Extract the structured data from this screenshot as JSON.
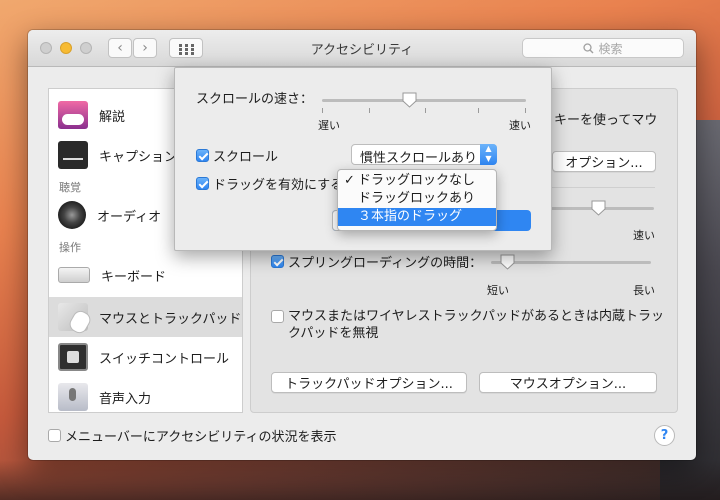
{
  "window": {
    "title": "アクセシビリティ",
    "search_placeholder": "検索"
  },
  "sidebar": {
    "items": [
      {
        "label": "解説",
        "icon": "speech-bubble-icon"
      },
      {
        "label": "キャプション",
        "icon": "captions-icon"
      },
      {
        "label": "オーディオ",
        "icon": "speaker-icon"
      },
      {
        "label": "キーボード",
        "icon": "keyboard-icon"
      },
      {
        "label": "マウスとトラックパッド",
        "icon": "mouse-trackpad-icon",
        "selected": true
      },
      {
        "label": "スイッチコントロール",
        "icon": "switch-control-icon"
      },
      {
        "label": "音声入力",
        "icon": "microphone-icon"
      }
    ],
    "headers": [
      "聴覚",
      "操作"
    ]
  },
  "pane": {
    "partial_text": "キーを使ってマウ",
    "options_button": "オプション...",
    "speed_fast": "速い",
    "spring_loading_label": "スプリングローディングの時間：",
    "spring_loading_checked": true,
    "spring_short": "短い",
    "spring_long": "長い",
    "spring_value": 0.1,
    "ignore_trackpad_label": "マウスまたはワイヤレストラックパッドがあるときは内蔵トラックパッドを無視",
    "ignore_trackpad_checked": false,
    "trackpad_options_button": "トラックパッドオプション...",
    "mouse_options_button": "マウスオプション..."
  },
  "popover": {
    "scroll_speed_label": "スクロールの速さ：",
    "slow": "遅い",
    "fast": "速い",
    "scroll_speed_value": 0.43,
    "scroll_label": "スクロール",
    "scroll_checked": true,
    "scroll_popup_value": "慣性スクロールあり",
    "drag_label": "ドラッグを有効にする",
    "drag_checked": true,
    "drag_menu": [
      {
        "label": "ドラッグロックなし",
        "checked": true,
        "highlighted": false
      },
      {
        "label": "ドラッグロックあり",
        "checked": false,
        "highlighted": false
      },
      {
        "label": "３本指のドラッグ",
        "checked": false,
        "highlighted": true
      }
    ]
  },
  "footer": {
    "show_status_label": "メニューバーにアクセシビリティの状況を表示",
    "show_status_checked": false,
    "help": "?"
  },
  "colors": {
    "accent": "#2f86f2",
    "window_bg": "#ececec"
  }
}
